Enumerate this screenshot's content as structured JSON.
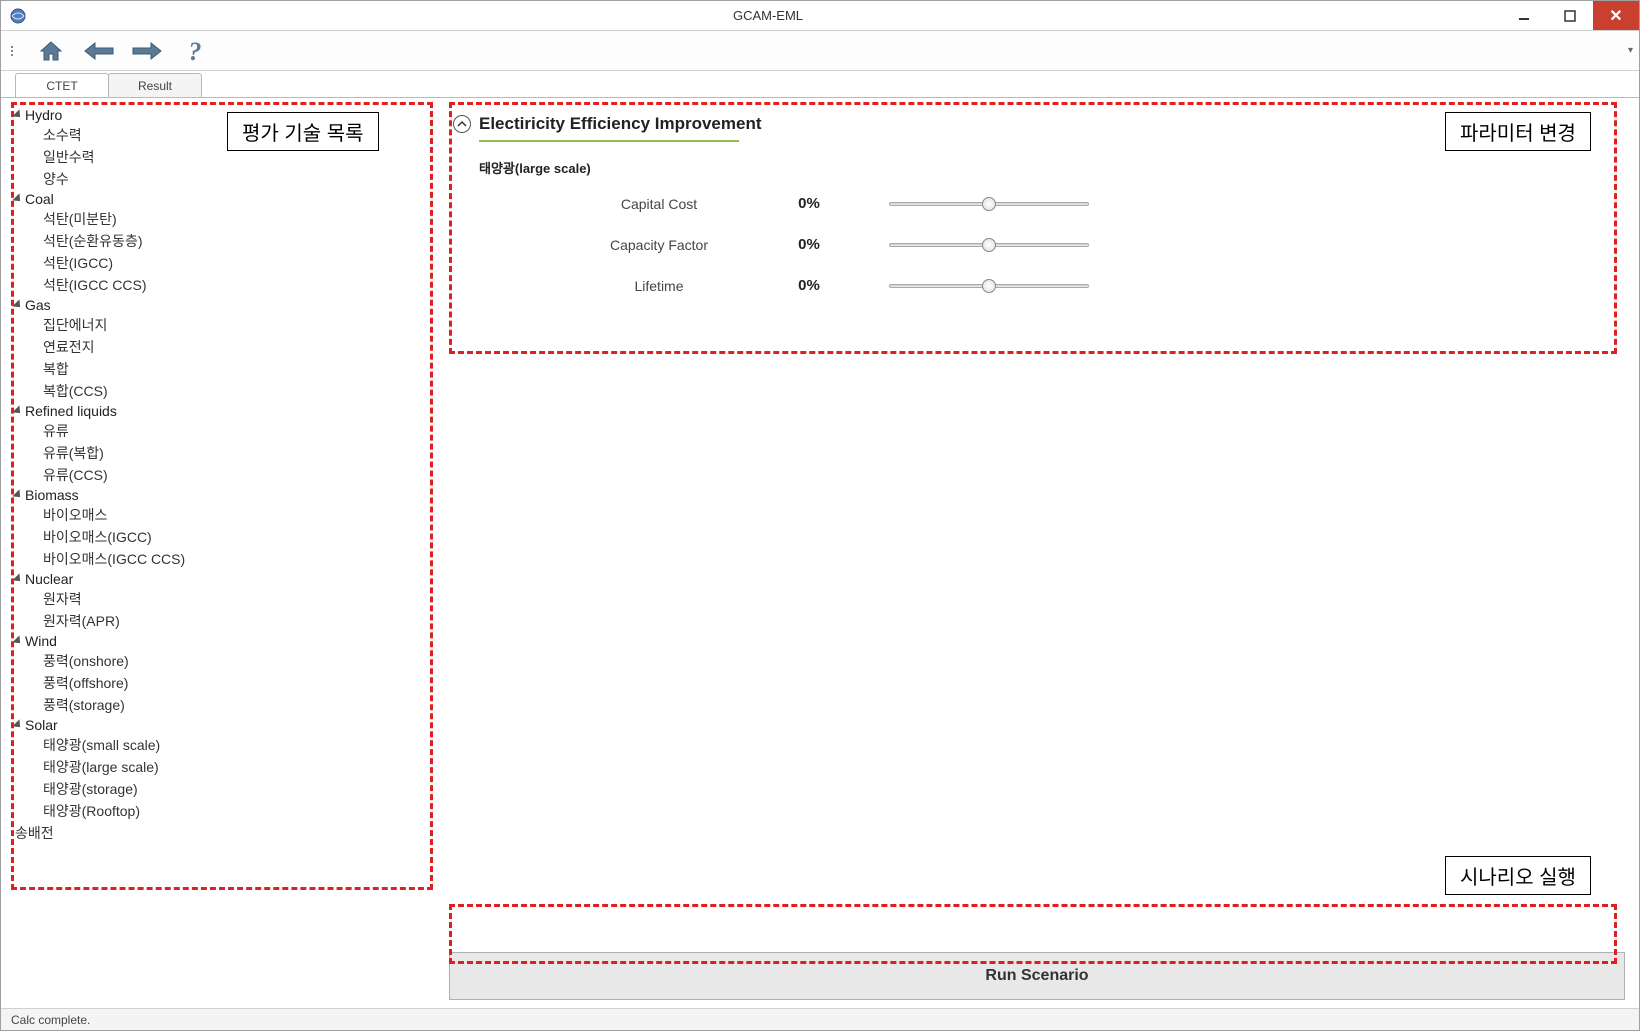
{
  "window": {
    "title": "GCAM-EML"
  },
  "tabs": [
    {
      "label": "CTET",
      "active": true
    },
    {
      "label": "Result",
      "active": false
    }
  ],
  "tree": [
    {
      "name": "Hydro",
      "children": [
        "소수력",
        "일반수력",
        "양수"
      ]
    },
    {
      "name": "Coal",
      "children": [
        "석탄(미분탄)",
        "석탄(순환유동층)",
        "석탄(IGCC)",
        "석탄(IGCC CCS)"
      ]
    },
    {
      "name": "Gas",
      "children": [
        "집단에너지",
        "연료전지",
        "복합",
        "복합(CCS)"
      ]
    },
    {
      "name": "Refined liquids",
      "children": [
        "유류",
        "유류(복합)",
        "유류(CCS)"
      ]
    },
    {
      "name": "Biomass",
      "children": [
        "바이오매스",
        "바이오매스(IGCC)",
        "바이오매스(IGCC CCS)"
      ]
    },
    {
      "name": "Nuclear",
      "children": [
        "원자력",
        "원자력(APR)"
      ]
    },
    {
      "name": "Wind",
      "children": [
        "풍력(onshore)",
        "풍력(offshore)",
        "풍력(storage)"
      ]
    },
    {
      "name": "Solar",
      "children": [
        "태양광(small scale)",
        "태양광(large scale)",
        "태양광(storage)",
        "태양광(Rooftop)"
      ]
    }
  ],
  "tree_leaf": "송배전",
  "param_panel": {
    "section_title": "Electiricity Efficiency Improvement",
    "subsection": "태양광(large scale)",
    "params": [
      {
        "label": "Capital Cost",
        "value": "0%"
      },
      {
        "label": "Capacity Factor",
        "value": "0%"
      },
      {
        "label": "Lifetime",
        "value": "0%"
      }
    ]
  },
  "run_button": "Run Scenario",
  "status": "Calc complete.",
  "annotations": {
    "tech_list": "평가 기술 목록",
    "param_change": "파라미터 변경",
    "scenario_run": "시나리오 실행"
  }
}
